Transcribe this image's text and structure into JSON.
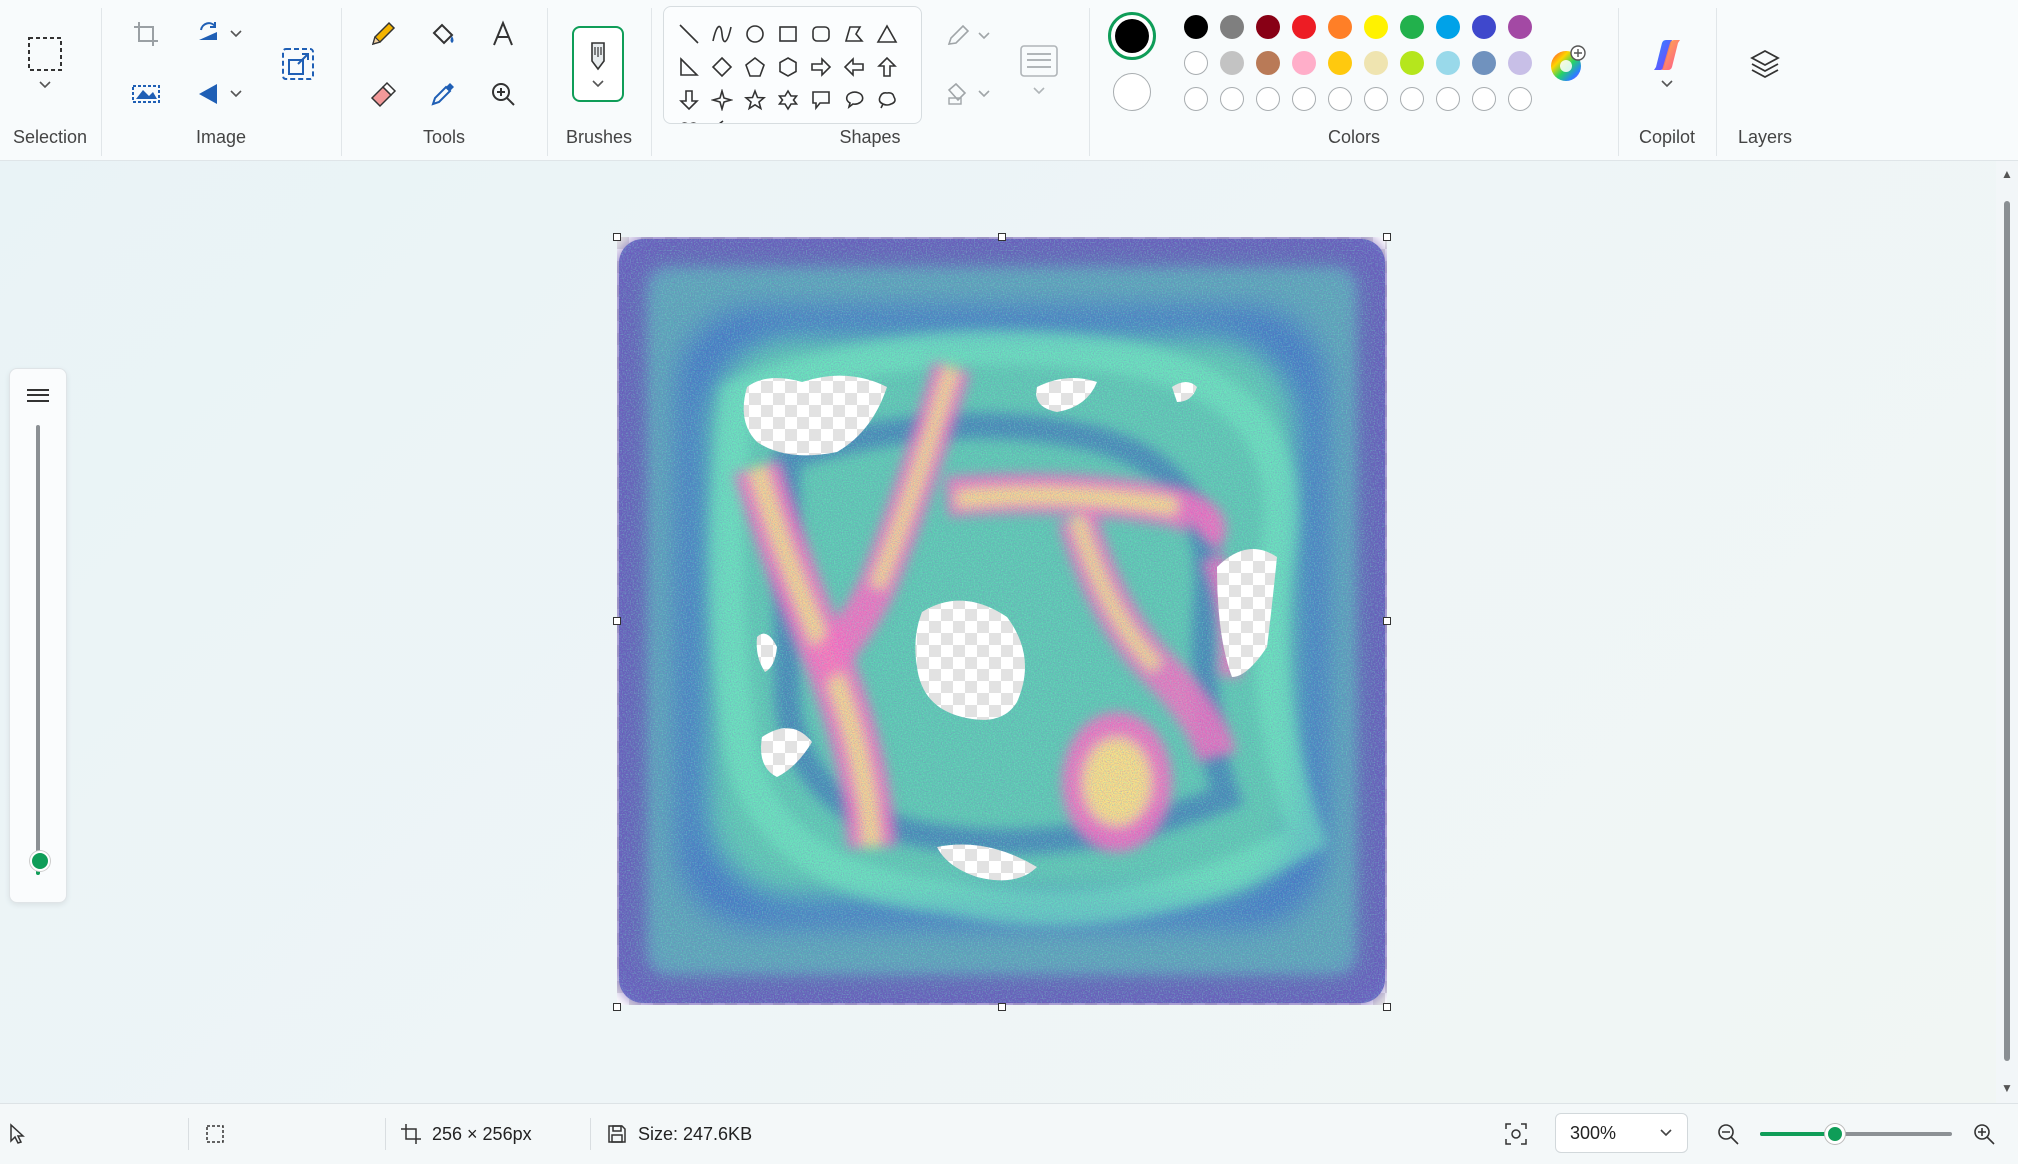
{
  "ribbon": {
    "groups": {
      "selection": "Selection",
      "image": "Image",
      "tools": "Tools",
      "brushes": "Brushes",
      "shapes": "Shapes",
      "colors": "Colors",
      "copilot": "Copilot",
      "layers": "Layers"
    },
    "colors": {
      "primary": "#000000",
      "secondary": "#ffffff",
      "palette_row1": [
        "#000000",
        "#7f7f7f",
        "#880015",
        "#ed1c24",
        "#ff7f27",
        "#fff200",
        "#22b14c",
        "#00a2e8",
        "#3f48cc",
        "#a349a4"
      ],
      "palette_row2": [
        "#ffffff",
        "#c3c3c3",
        "#b97a57",
        "#ffaec9",
        "#ffc90e",
        "#efe4b0",
        "#b5e61d",
        "#99d9ea",
        "#7092be",
        "#c8bfe7"
      ],
      "palette_row3_custom_slots": 10
    },
    "icons": {
      "selection": "rectangle-select-icon",
      "crop": "crop-icon",
      "rotate": "rotate-icon",
      "resize": "resize-icon",
      "flip": "flip-icon",
      "remove_bg": "remove-background-icon",
      "pencil": "pencil-icon",
      "fill": "fill-bucket-icon",
      "text": "text-icon",
      "eraser": "eraser-icon",
      "picker": "color-picker-icon",
      "magnifier": "magnifier-icon",
      "brush": "brush-icon",
      "outline": "shape-outline-icon",
      "shape_fill": "shape-fill-icon",
      "stroke_size": "stroke-size-icon",
      "edit_colors": "color-wheel-icon",
      "copilot": "copilot-icon",
      "layers": "layers-icon"
    }
  },
  "canvas": {
    "image_description": "noisy psychedelic texture with transparent regions",
    "accent": "#0f9d58"
  },
  "statusbar": {
    "dimensions": "256 × 256px",
    "size": "Size: 247.6KB",
    "zoom": "300%"
  }
}
